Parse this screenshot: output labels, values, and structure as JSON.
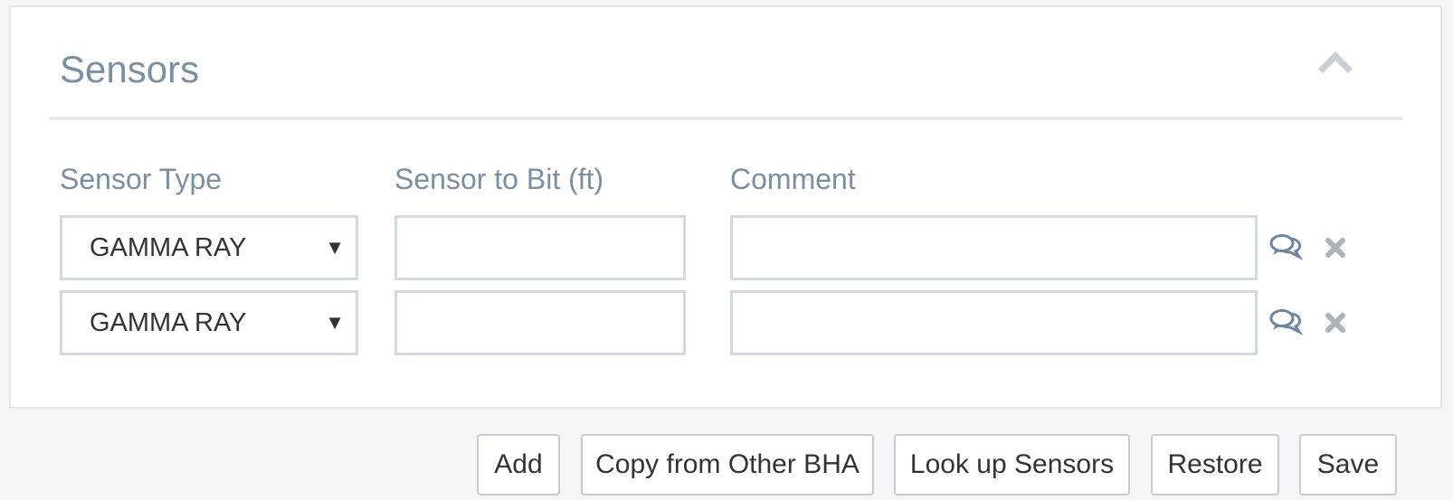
{
  "panel": {
    "title": "Sensors"
  },
  "columns": {
    "sensor_type": "Sensor Type",
    "sensor_to_bit": "Sensor to Bit (ft)",
    "comment": "Comment"
  },
  "rows": [
    {
      "sensor_type": "GAMMA RAY",
      "sensor_to_bit": "",
      "comment": ""
    },
    {
      "sensor_type": "GAMMA RAY",
      "sensor_to_bit": "",
      "comment": ""
    }
  ],
  "select_arrow": "▼",
  "icons": {
    "collapse": "chevron-up-icon",
    "comment": "comments-icon",
    "remove": "close-icon"
  },
  "colors": {
    "heading": "#7a8fa3",
    "icon_blue": "#6e86a0",
    "icon_gray": "#aab2ba",
    "border": "#d3d9de"
  },
  "buttons": {
    "add": "Add",
    "copy_from_other_bha": "Copy from Other BHA",
    "look_up_sensors": "Look up Sensors",
    "restore": "Restore",
    "save": "Save"
  }
}
